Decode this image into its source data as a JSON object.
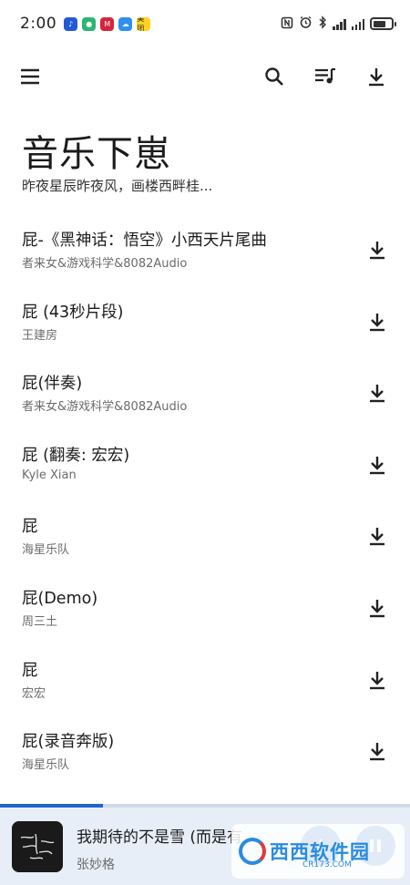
{
  "status_bar": {
    "time": "2:00",
    "apps": [
      {
        "name": "music-app-icon",
        "color": "#2459d6",
        "glyph": "♪"
      },
      {
        "name": "green-app-icon",
        "color": "#2bb673",
        "glyph": "●"
      },
      {
        "name": "red-app-icon",
        "color": "#d6243c",
        "glyph": "M"
      },
      {
        "name": "cloud-app-icon",
        "color": "#2f8ef0",
        "glyph": "☁"
      },
      {
        "name": "meituan-app-icon",
        "color": "#ffd21f",
        "glyph": "美团"
      }
    ],
    "battery_level": 0.7
  },
  "toolbar": {
    "menu_icon": "menu-icon",
    "search_icon": "search-icon",
    "playlist_icon": "playlist-icon",
    "download_icon": "download-icon"
  },
  "header": {
    "title": "音乐下崽",
    "subtitle": "昨夜星辰昨夜风，画楼西畔桂..."
  },
  "songs": [
    {
      "title": "屁-《黑神话：悟空》小西天片尾曲",
      "artist": "者来女&游戏科学&8082Audio"
    },
    {
      "title": "屁 (43秒片段)",
      "artist": "王建房"
    },
    {
      "title": "屁(伴奏)",
      "artist": "者来女&游戏科学&8082Audio"
    },
    {
      "title": "屁 (翻奏: 宏宏)",
      "artist": "Kyle Xian"
    },
    {
      "title": "屁",
      "artist": "海星乐队"
    },
    {
      "title": "屁(Demo)",
      "artist": "周三土"
    },
    {
      "title": "屁",
      "artist": "宏宏"
    },
    {
      "title": "屁(录音奔版)",
      "artist": "海星乐队"
    }
  ],
  "player": {
    "title": "我期待的不是雪 (而是有...",
    "artist": "张妙格",
    "progress": 0.25
  },
  "watermark": {
    "text": "西西软件园",
    "sub": "CR173.COM"
  },
  "colors": {
    "accent": "#2b6fcf",
    "player_bg": "#e7eef7"
  }
}
